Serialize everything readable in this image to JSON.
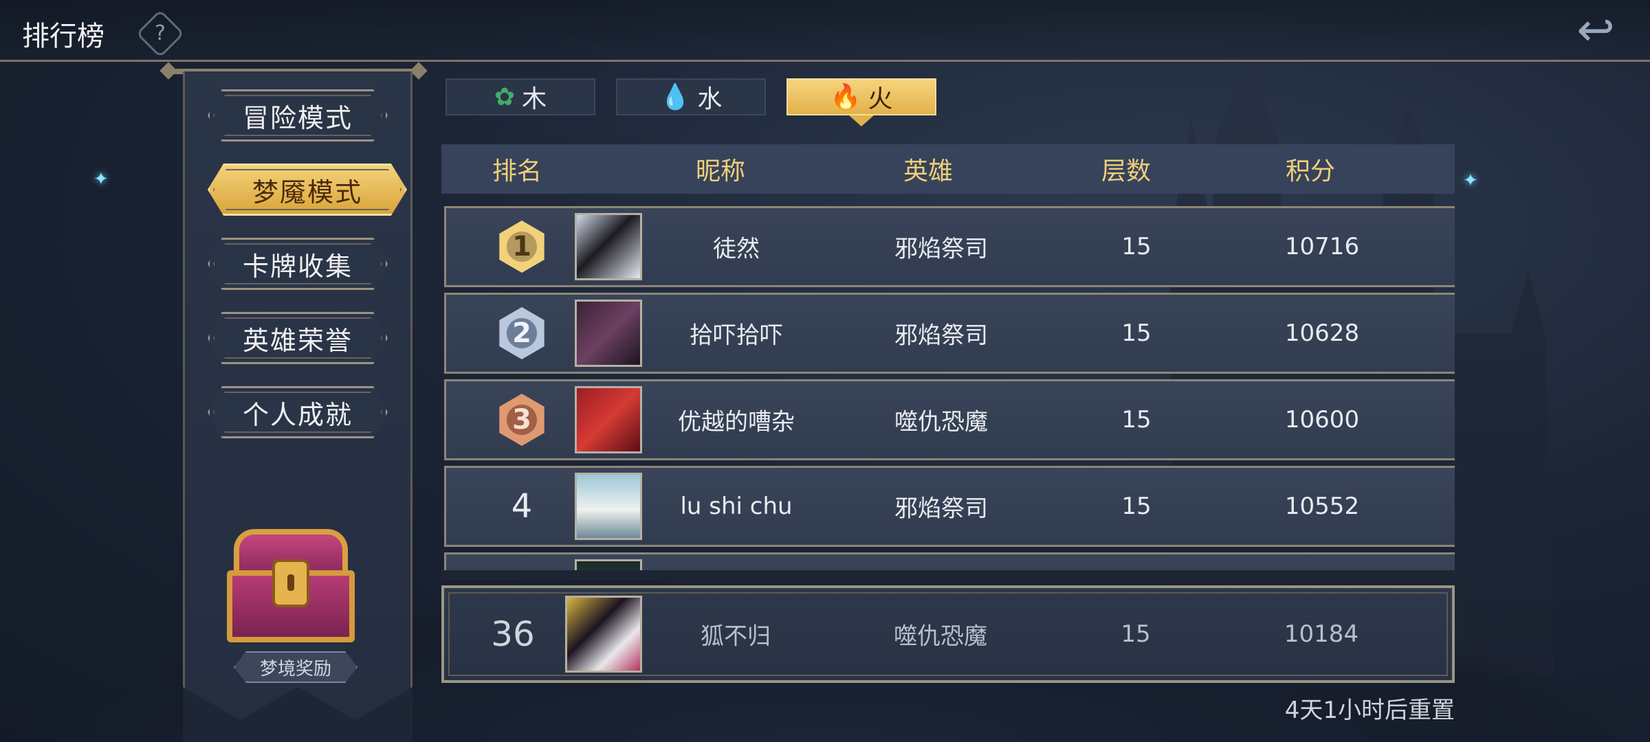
{
  "header": {
    "title": "排行榜",
    "help_icon": "?",
    "back_icon": "↩"
  },
  "left_menu": {
    "items": [
      {
        "label": "冒险模式",
        "active": false
      },
      {
        "label": "梦魇模式",
        "active": true
      },
      {
        "label": "卡牌收集",
        "active": false
      },
      {
        "label": "英雄荣誉",
        "active": false
      },
      {
        "label": "个人成就",
        "active": false
      }
    ],
    "reward_label": "梦境奖励"
  },
  "tabs": [
    {
      "label": "木",
      "icon": "leaf-icon",
      "color": "#3fae6a",
      "active": false
    },
    {
      "label": "水",
      "icon": "water-drop-icon",
      "color": "#3aa7e0",
      "active": false
    },
    {
      "label": "火",
      "icon": "flame-icon",
      "color": "#d8342a",
      "active": true
    }
  ],
  "table": {
    "headers": {
      "rank": "排名",
      "nickname": "昵称",
      "hero": "英雄",
      "floors": "层数",
      "score": "积分"
    },
    "rows": [
      {
        "rank": "1",
        "nickname": "徒然",
        "hero": "邪焰祭司",
        "floors": "15",
        "score": "10716"
      },
      {
        "rank": "2",
        "nickname": "拾吓拾吓",
        "hero": "邪焰祭司",
        "floors": "15",
        "score": "10628"
      },
      {
        "rank": "3",
        "nickname": "优越的嘈杂",
        "hero": "噬仇恐魔",
        "floors": "15",
        "score": "10600"
      },
      {
        "rank": "4",
        "nickname": "lu shi chu",
        "hero": "邪焰祭司",
        "floors": "15",
        "score": "10552"
      }
    ],
    "self_row": {
      "rank": "36",
      "nickname": "狐不归",
      "hero": "噬仇恐魔",
      "floors": "15",
      "score": "10184"
    }
  },
  "reset_text": "4天1小时后重置"
}
